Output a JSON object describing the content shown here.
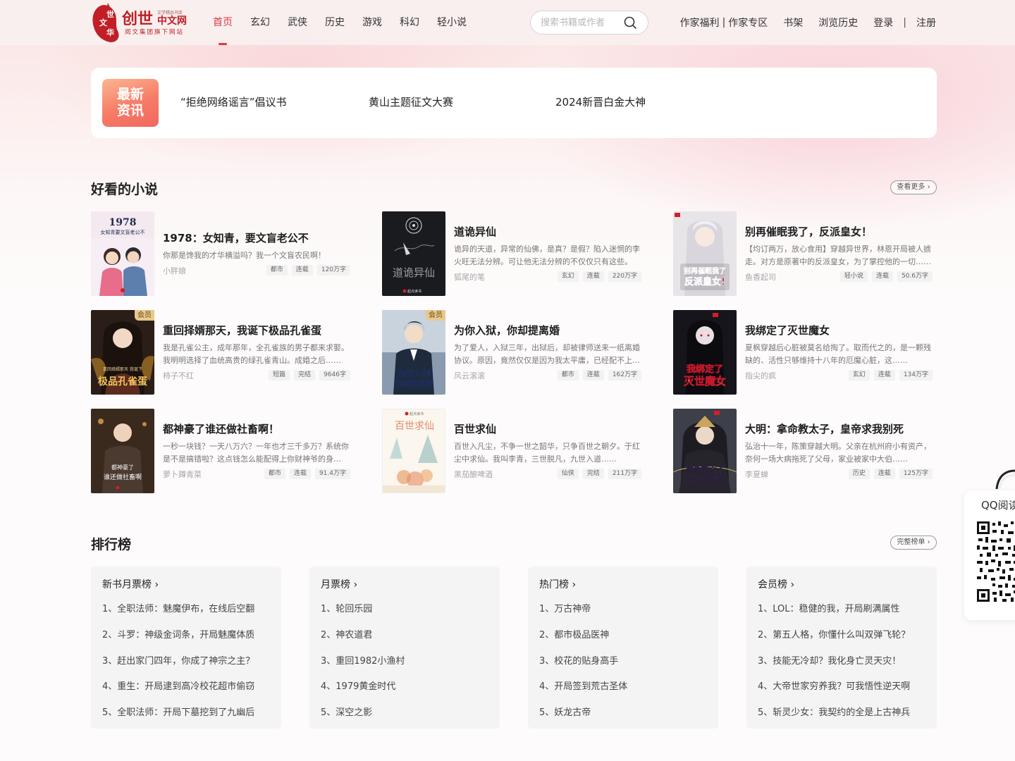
{
  "header": {
    "logo_text": "创世中文网",
    "logo_sub": "阅文集团旗下网站",
    "logo_tagline": "文学精品书库",
    "nav": [
      "首页",
      "玄幻",
      "武侠",
      "历史",
      "游戏",
      "科幻",
      "轻小说"
    ],
    "active_nav": "首页",
    "search_placeholder": "搜索书籍或作者",
    "links": {
      "author_welfare": "作家福利",
      "divider": "|",
      "author_zone": "作家专区",
      "bookshelf": "书架",
      "history": "浏览历史",
      "login": "登录",
      "sep": "|",
      "register": "注册"
    }
  },
  "news": {
    "badge": "最新资讯",
    "items": [
      "“拒绝网络谣言”倡议书",
      "黄山主题征文大赛",
      "2024新晋白金大神"
    ]
  },
  "novels": {
    "title": "好看的小说",
    "more": "查看更多",
    "books": [
      {
        "title": "1978：女知青，要文盲老公不",
        "desc": "你那是馋我的才华横溢吗？我一个文盲农民啊！",
        "author": "小胖娘",
        "tags": [
          "都市",
          "连载",
          "120万字"
        ],
        "vip": false,
        "cover_text": "1978 女知青要文盲老公不"
      },
      {
        "title": "道诡异仙",
        "desc": "诡异的天道，异常的仙佛，是真？是假？陷入迷惘的李火旺无法分辨。可让他无法分辨的不仅仅只有这些。",
        "author": "狐尾的笔",
        "tags": [
          "玄幻",
          "连载",
          "220万字"
        ],
        "vip": false,
        "cover_text": "道诡异仙"
      },
      {
        "title": "别再催眠我了，反派皇女！",
        "desc": "【均订两万，放心食用】穿越异世界，林恩开局被人掳走。对方是原著中的反派皇女，为了掌控他的一切……",
        "author": "鱼香起司",
        "tags": [
          "轻小说",
          "连载",
          "50.6万字"
        ],
        "vip": false,
        "cover_text": "别再催眠我了 反派皇女"
      },
      {
        "title": "重回择婿那天，我诞下极品孔雀蛋",
        "desc": "我是孔雀公主，成年那年，全孔雀族的男子都来求娶。我明明选择了血统高贵的绿孔雀青山。成婚之后……",
        "author": "柿子不红",
        "tags": [
          "短篇",
          "完结",
          "9646字"
        ],
        "vip": true,
        "cover_text": "极品孔雀蛋"
      },
      {
        "title": "为你入狱，你却提离婚",
        "desc": "为了爱人，入狱三年，出狱后，却被律师送来一纸离婚协议。原因，竟然仅仅是因为我太平庸，已经配不上她……",
        "author": "风云滚滚",
        "tags": [
          "都市",
          "连载",
          "162万字"
        ],
        "vip": true,
        "cover_text": "为你入狱 你却提离婚"
      },
      {
        "title": "我绑定了灭世魔女",
        "desc": "夏枫穿越后心脏被莫名给掏了。取而代之的，是一颗残缺的、活性只够维持十八年的厄魔心脏，这……",
        "author": "指尖的疯",
        "tags": [
          "玄幻",
          "连载",
          "134万字"
        ],
        "vip": false,
        "cover_text": "我绑定了 灭世魔女"
      },
      {
        "title": "都神豪了谁还做社畜啊！",
        "desc": "一秒一块钱？一天八万六？一年也才三千多万？系统你是不是搞错啦？这点钱怎么能配得上你财神爷的身份……",
        "author": "萝卜蹲青菜",
        "tags": [
          "都市",
          "连载",
          "91.4万字"
        ],
        "vip": false,
        "cover_text": "都神豪了 谁还做社畜啊"
      },
      {
        "title": "百世求仙",
        "desc": "百世入凡尘，不争一世之韶华，只争百世之朝夕。于红尘中求仙。我叫李青，三世脱凡，九世入道……",
        "author": "黑茄酿啤酒",
        "tags": [
          "仙侠",
          "完结",
          "211万字"
        ],
        "vip": false,
        "cover_text": "百世求仙"
      },
      {
        "title": "大明：拿命教太子，皇帝求我别死",
        "desc": "弘治十一年，陈策穿越大明。父亲在杭州府小有资产，奈何一场大病拖死了父母，家业被家中大伯……",
        "author": "李夏蝉",
        "tags": [
          "历史",
          "连载",
          "125万字"
        ],
        "vip": false,
        "cover_text": "大明 拿命教太子"
      }
    ]
  },
  "ranking": {
    "title": "排行榜",
    "more": "完整榜单",
    "lists": [
      {
        "name": "新书月票榜",
        "items": [
          "1、全职法师：魅魔伊布，在线后空翻",
          "2、斗罗：神级金词条，开局魅魔体质",
          "3、赶出家门四年，你成了神宗之主？",
          "4、重生：开局逮到高冷校花超市偷窃",
          "5、全职法师：开局下墓挖到了九幽后"
        ]
      },
      {
        "name": "月票榜",
        "items": [
          "1、轮回乐园",
          "2、神农道君",
          "3、重回1982小渔村",
          "4、1979黄金时代",
          "5、深空之影"
        ]
      },
      {
        "name": "热门榜",
        "items": [
          "1、万古神帝",
          "2、都市极品医神",
          "3、校花的贴身高手",
          "4、开局签到荒古圣体",
          "5、妖龙古帝"
        ]
      },
      {
        "name": "会员榜",
        "items": [
          "1、LOL：稳健的我，开局刷满属性",
          "2、第五人格，你懂什么叫双弹飞轮？",
          "3、技能无冷却？我化身亡灵天灾！",
          "4、大帝世家穷养我？可我悟性逆天啊",
          "5、斩灵少女：我契约的全是上古神兵"
        ]
      }
    ]
  },
  "qq": {
    "title": "QQ阅读"
  },
  "colors": {
    "accent": "#e0383e",
    "badge": "#f4735f",
    "vip": "#e8c98c"
  },
  "icons": {
    "search": "search-icon",
    "chevron": "chevron-right-icon"
  }
}
